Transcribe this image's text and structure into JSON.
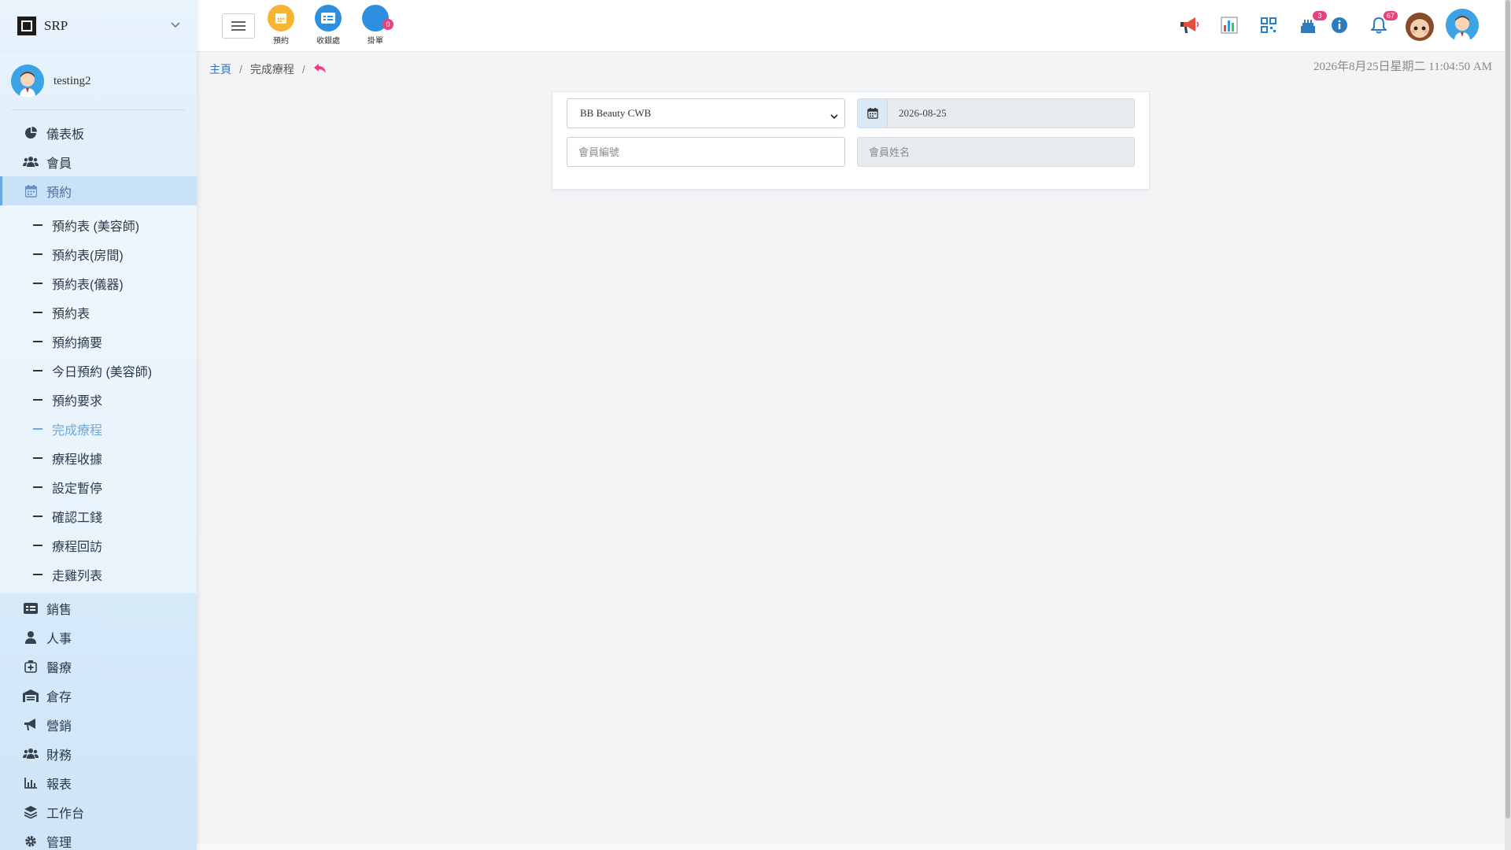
{
  "brand": {
    "name": "SRP"
  },
  "user": {
    "name": "testing2"
  },
  "sidebar": {
    "items": [
      {
        "label": "儀表板",
        "icon": "chart-pie-icon"
      },
      {
        "label": "會員",
        "icon": "users-icon"
      },
      {
        "label": "預約",
        "icon": "calendar-icon",
        "active": true
      }
    ],
    "sub_items": [
      {
        "label": "預約表 (美容師)"
      },
      {
        "label": "預約表(房間)"
      },
      {
        "label": "預約表(儀器)"
      },
      {
        "label": "預約表"
      },
      {
        "label": "預約摘要"
      },
      {
        "label": "今日預約 (美容師)"
      },
      {
        "label": "預約要求"
      },
      {
        "label": "完成療程",
        "current": true
      },
      {
        "label": "療程收據"
      },
      {
        "label": "設定暫停"
      },
      {
        "label": "確認工錢"
      },
      {
        "label": "療程回訪"
      },
      {
        "label": "走雞列表"
      }
    ],
    "bottom_items": [
      {
        "label": "銷售",
        "icon": "receipt-icon"
      },
      {
        "label": "人事",
        "icon": "person-icon"
      },
      {
        "label": "醫療",
        "icon": "medical-icon"
      },
      {
        "label": "倉存",
        "icon": "warehouse-icon"
      },
      {
        "label": "營銷",
        "icon": "megaphone-icon"
      },
      {
        "label": "財務",
        "icon": "users-icon"
      },
      {
        "label": "報表",
        "icon": "bar-chart-icon"
      },
      {
        "label": "工作台",
        "icon": "layers-icon"
      },
      {
        "label": "管理",
        "icon": "gear-icon"
      }
    ]
  },
  "topbar": {
    "quick": [
      {
        "label": "預約",
        "color": "#f5b431"
      },
      {
        "label": "收銀處",
        "color": "#2d8fe0"
      },
      {
        "label": "掛單",
        "color": "#2d8fe0",
        "badge": "0"
      }
    ],
    "badges": {
      "cake": "3",
      "bell": "67"
    }
  },
  "breadcrumb": {
    "home": "主頁",
    "current": "完成療程"
  },
  "datetime": "2026年8月25日星期二 11:04:50 AM",
  "form": {
    "shop_selected": "BB Beauty CWB",
    "date_value": "2026-08-25",
    "member_no_placeholder": "會員編號",
    "member_name_placeholder": "會員姓名"
  },
  "colors": {
    "accent": "#6ea7d8",
    "badge": "#e8417d",
    "sidebar_bg": "#dcedfa"
  }
}
